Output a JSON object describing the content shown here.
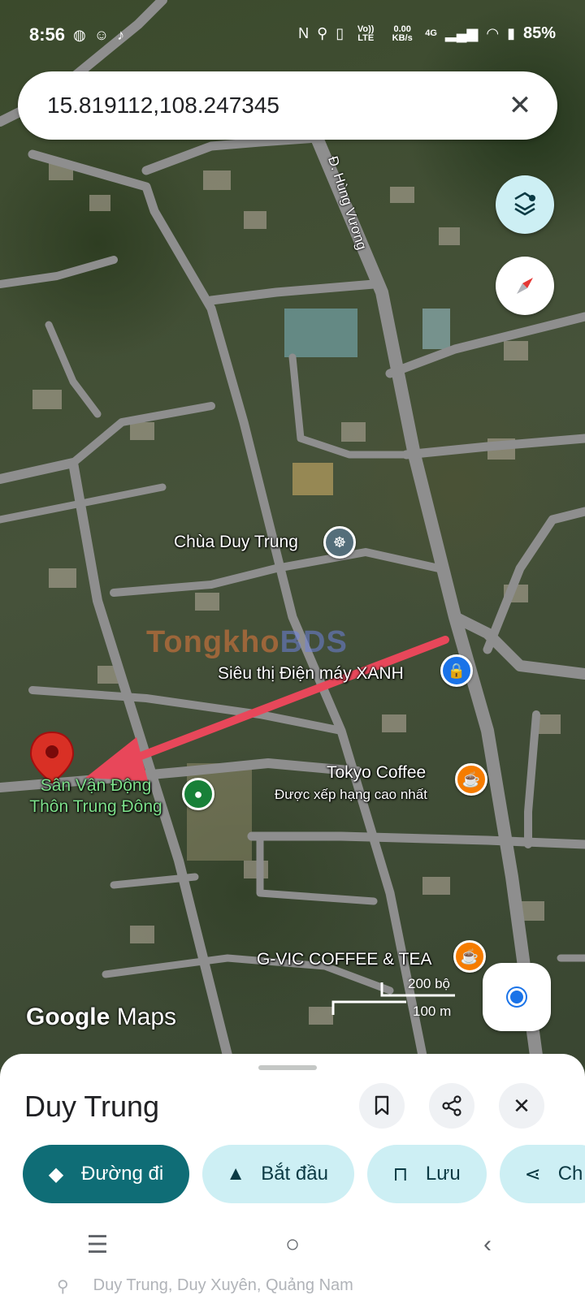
{
  "status_bar": {
    "time": "8:56",
    "network_top": "Vo)) LTE",
    "speed": "0.00 KB/s",
    "net_type": "4G",
    "battery": "85%"
  },
  "search": {
    "value": "15.819112,108.247345",
    "clear_icon": "close-icon"
  },
  "map": {
    "road_label": "Đ. Hùng Vương",
    "labels": {
      "pagoda": "Chùa Duy Trung",
      "supermarket": "Siêu thị Điện máy XANH",
      "cafe1_name": "Tokyo Coffee",
      "cafe1_sub": "Được xếp hạng cao nhất",
      "stadium_line1": "Sân Vận Động",
      "stadium_line2": "Thôn Trung Đông",
      "cafe2_name": "G-VIC COFFEE & TEA"
    },
    "watermark_part1": "Tongkho",
    "watermark_part2": "BDS",
    "scale_top": "200 bộ",
    "scale_bottom": "100 m",
    "logo_google": "Google",
    "logo_maps": "Maps",
    "colors": {
      "road": "#8e8e8e",
      "pin_red": "#d93025",
      "arrow": "#e8475a",
      "pin_blue": "#1a73e8",
      "pin_orange": "#f57c00",
      "pin_green": "#188038"
    }
  },
  "sheet": {
    "title": "Duy Trung",
    "chips": [
      {
        "label": "Đường đi",
        "icon": "directions-icon"
      },
      {
        "label": "Bắt đầu",
        "icon": "navigation-icon"
      },
      {
        "label": "Lưu",
        "icon": "bookmark-icon"
      },
      {
        "label": "Ch",
        "icon": "share-icon"
      }
    ],
    "peek": "Duy Trung, Duy Xuyên, Quảng Nam"
  }
}
